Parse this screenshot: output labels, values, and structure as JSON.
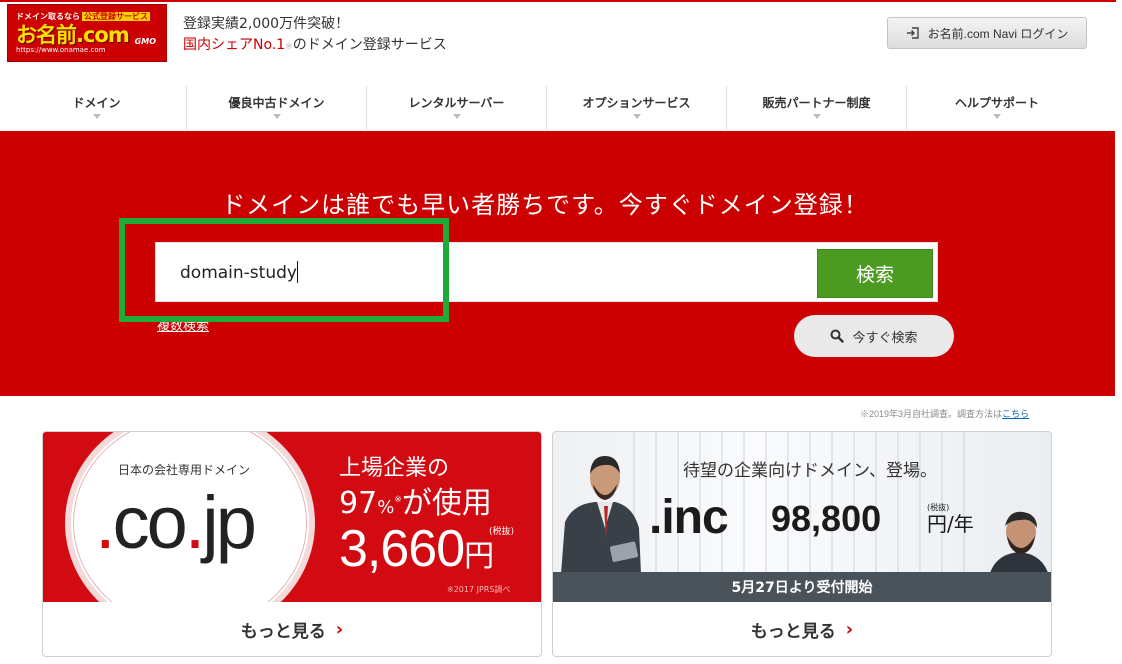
{
  "header": {
    "logo": {
      "line1": "ドメイン取るなら",
      "tag": "公式登録サービス",
      "brand": "お名前.com",
      "domains": ".com .jp .co.jp",
      "url": "https://www.onamae.com",
      "company": "GMO"
    },
    "tagline_main": "登録実績2,000万件突破！",
    "tagline_red": "国内シェアNo.1",
    "tagline_note": "※",
    "tagline_rest": "のドメイン登録サービス",
    "login_label": "お名前.com Navi ログイン"
  },
  "nav": {
    "items": [
      {
        "label": "ドメイン"
      },
      {
        "label": "優良中古ドメイン"
      },
      {
        "label": "レンタルサーバー"
      },
      {
        "label": "オプションサービス"
      },
      {
        "label": "販売パートナー制度"
      },
      {
        "label": "ヘルプサポート"
      }
    ]
  },
  "hero": {
    "title": "ドメインは誰でも早い者勝ちです。今すぐドメイン登録！",
    "search_value": "domain-study",
    "search_button": "検索",
    "bulk_search": "複数検索",
    "instant_search": "今すぐ検索"
  },
  "survey_note": {
    "text": "※2019年3月自社調査。調査方法は",
    "link": "こちら"
  },
  "cards": {
    "cojp": {
      "subtitle": "日本の会社専用ドメイン",
      "domain_prefix": ".",
      "domain_co": "co",
      "domain_jp": "jp",
      "line1": "上場企業の",
      "pct": "97",
      "pct_unit": "%",
      "pct_mark": "※",
      "line2_rest": "が使用",
      "price": "3,660",
      "price_unit": "円",
      "tax": "(税抜)",
      "footnote": "※2017 JPRS調べ",
      "more": "もっと見る"
    },
    "inc": {
      "lead": "待望の企業向けドメイン、登場。",
      "domain": ".inc",
      "price": "98,800",
      "unit": "円/年",
      "tax": "(税抜)",
      "start": "5月27日より受付開始",
      "more": "もっと見る"
    }
  },
  "colors": {
    "brand_red": "#cc0000",
    "search_green": "#4b9b23",
    "highlight_green": "#1fab38"
  }
}
